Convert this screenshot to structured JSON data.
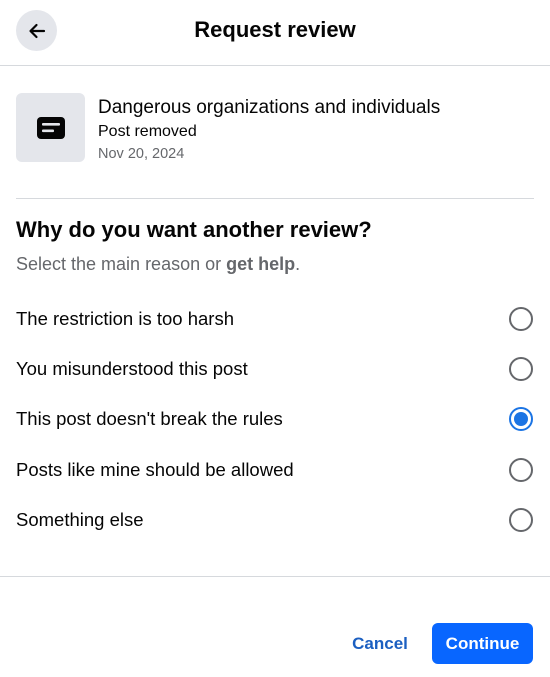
{
  "header": {
    "title": "Request review",
    "back_icon": "arrow-left-icon"
  },
  "post": {
    "icon": "post-document-icon",
    "title": "Dangerous organizations and individuals",
    "status": "Post removed",
    "date": "Nov 20, 2024"
  },
  "question": {
    "heading": "Why do you want another review?",
    "subtitle_prefix": "Select the main reason or ",
    "help_link": "get help",
    "subtitle_suffix": "."
  },
  "options": [
    {
      "label": "The restriction is too harsh",
      "selected": false
    },
    {
      "label": "You misunderstood this post",
      "selected": false
    },
    {
      "label": "This post doesn't break the rules",
      "selected": true
    },
    {
      "label": "Posts like mine should be allowed",
      "selected": false
    },
    {
      "label": "Something else",
      "selected": false
    }
  ],
  "footer": {
    "cancel_label": "Cancel",
    "continue_label": "Continue"
  },
  "colors": {
    "accent": "#0866ff",
    "link": "#1b5fc1",
    "radio_selected": "#1b74e4",
    "muted_text": "#65676b"
  }
}
